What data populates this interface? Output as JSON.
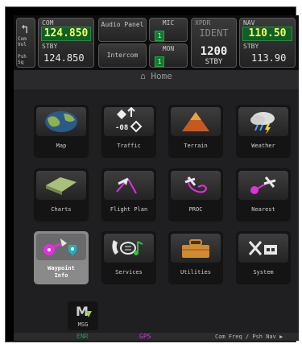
{
  "topbar": {
    "back": {
      "small1": "Com",
      "small2": "Vol",
      "small3": "Psh",
      "small4": "Sq"
    },
    "com": {
      "label": "COM",
      "active": "124.850",
      "stby_label": "STBY",
      "standby": "124.850"
    },
    "audio_panel": "Audio Panel",
    "intercom": "Intercom",
    "mic": {
      "label": "MIC",
      "value": "1"
    },
    "mon": {
      "label": "MON",
      "value": "1"
    },
    "xpdr": {
      "label": "XPDR",
      "mode": "IDENT",
      "code": "1200",
      "state": "STBY"
    },
    "nav": {
      "label": "NAV",
      "active": "110.50",
      "stby_label": "STBY",
      "standby": "113.90"
    }
  },
  "home_title": "Home",
  "tiles": [
    {
      "label": "Map",
      "icon": "globe-icon"
    },
    {
      "label": "Traffic",
      "icon": "traffic-icon",
      "value": "-08"
    },
    {
      "label": "Terrain",
      "icon": "terrain-icon"
    },
    {
      "label": "Weather",
      "icon": "weather-icon"
    },
    {
      "label": "Charts",
      "icon": "charts-icon"
    },
    {
      "label": "Flight Plan",
      "icon": "flight-plan-icon"
    },
    {
      "label": "PROC",
      "icon": "proc-icon"
    },
    {
      "label": "Nearest",
      "icon": "nearest-icon"
    },
    {
      "label": "Waypoint Info",
      "label1": "Waypoint",
      "label2": "Info",
      "icon": "waypoint-info-icon",
      "selected": true
    },
    {
      "label": "Services",
      "icon": "services-icon"
    },
    {
      "label": "Utilities",
      "icon": "toolbox-icon"
    },
    {
      "label": "System",
      "icon": "system-icon"
    }
  ],
  "msg": "MSG",
  "bottom": {
    "enr": "ENR",
    "gps": "GPS",
    "hint": "Com Freq / Psh Nav"
  },
  "colors": {
    "active_green": "#0f5f26",
    "freq_yellow": "#f0ff60",
    "magenta": "#e030e0",
    "enr_green": "#1fa34a"
  }
}
